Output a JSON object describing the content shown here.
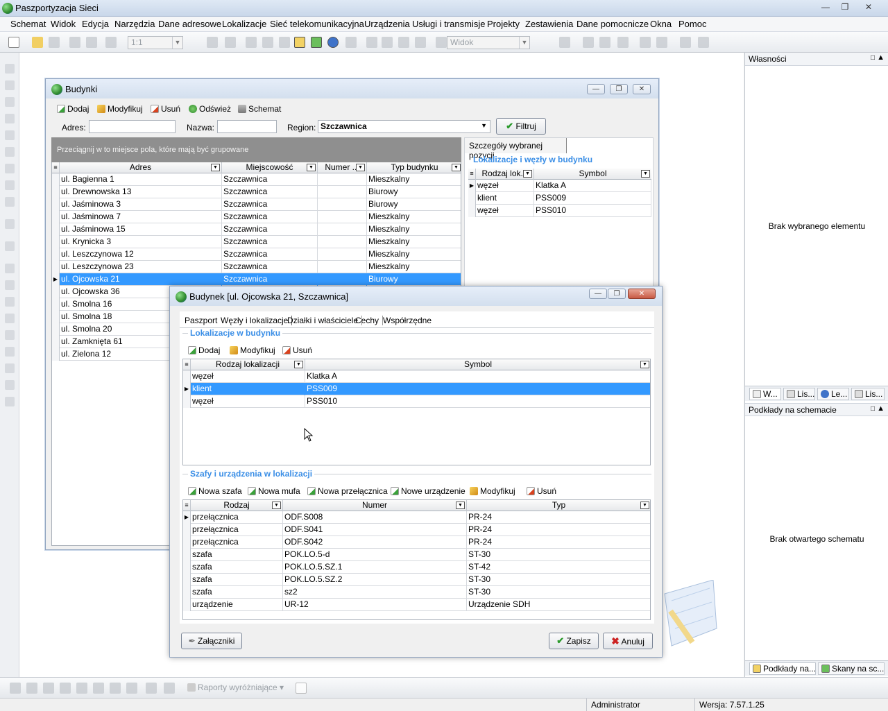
{
  "app": {
    "title": "Paszportyzacja Sieci"
  },
  "menu": [
    "Schemat",
    "Widok",
    "Edycja",
    "Narzędzia",
    "Dane adresowe",
    "Lokalizacje",
    "Sieć telekomunikacyjna",
    "Urządzenia",
    "Usługi i transmisje",
    "Projekty",
    "Zestawienia",
    "Dane pomocnicze",
    "Okna",
    "Pomoc"
  ],
  "toolbar": {
    "zoom_value": "1:1",
    "view_value": "Widok"
  },
  "right_panel": {
    "properties_title": "Własności",
    "properties_empty": "Brak wybranego elementu",
    "tabs": [
      "W...",
      "Lis...",
      "Le...",
      "Lis..."
    ],
    "underlays_title": "Podkłady na schemacie",
    "underlays_empty": "Brak otwartego schematu",
    "bottom_tabs": [
      "Podkłady na...",
      "Skany na sc..."
    ]
  },
  "bottom_toolbar": {
    "reports_label": "Raporty wyróżniające"
  },
  "status": {
    "user": "Administrator",
    "version": "Wersja: 7.57.1.25"
  },
  "buildings": {
    "title": "Budynki",
    "buttons": [
      "Dodaj",
      "Modyfikuj",
      "Usuń",
      "Odśwież",
      "Schemat"
    ],
    "filter": {
      "address_label": "Adres:",
      "address_value": "",
      "name_label": "Nazwa:",
      "name_value": "",
      "region_label": "Region:",
      "region_value": "Szczawnica",
      "filter_button": "Filtruj"
    },
    "group_hint": "Przeciągnij w to miejsce pola, które mają być grupowane",
    "columns": [
      "Adres",
      "Miejscowość",
      "Numer ...",
      "Typ budynku"
    ],
    "rows": [
      [
        "ul. Bagienna 1",
        "Szczawnica",
        "",
        "Mieszkalny"
      ],
      [
        "ul. Drewnowska 13",
        "Szczawnica",
        "",
        "Biurowy"
      ],
      [
        "ul. Jaśminowa 3",
        "Szczawnica",
        "",
        "Biurowy"
      ],
      [
        "ul. Jaśminowa 7",
        "Szczawnica",
        "",
        "Mieszkalny"
      ],
      [
        "ul. Jaśminowa 15",
        "Szczawnica",
        "",
        "Mieszkalny"
      ],
      [
        "ul. Krynicka 3",
        "Szczawnica",
        "",
        "Mieszkalny"
      ],
      [
        "ul. Leszczynowa 12",
        "Szczawnica",
        "",
        "Mieszkalny"
      ],
      [
        "ul. Leszczynowa 23",
        "Szczawnica",
        "",
        "Mieszkalny"
      ],
      [
        "ul. Ojcowska 21",
        "Szczawnica",
        "",
        "Biurowy"
      ],
      [
        "ul. Ojcowska 36",
        "",
        "",
        ""
      ],
      [
        "ul. Smolna 16",
        "",
        "",
        ""
      ],
      [
        "ul. Smolna 18",
        "",
        "",
        ""
      ],
      [
        "ul. Smolna 20",
        "",
        "",
        ""
      ],
      [
        "ul. Zamknięta 61",
        "",
        "",
        ""
      ],
      [
        "ul. Zielona 12",
        "",
        "",
        ""
      ]
    ],
    "selected_row": 8,
    "details": {
      "tab": "Szczegóły wybranej pozycji",
      "section": "Lokalizacje i węzły w budynku",
      "columns": [
        "Rodzaj lok...",
        "Symbol"
      ],
      "rows": [
        [
          "węzeł",
          "Klatka A"
        ],
        [
          "klient",
          "PSS009"
        ],
        [
          "węzeł",
          "PSS010"
        ]
      ]
    }
  },
  "building": {
    "title": "Budynek [ul. Ojcowska 21, Szczawnica]",
    "tabs": [
      "Paszport",
      "Węzły i lokalizacje",
      "Działki i właściciele",
      "Cechy",
      "Współrzędne"
    ],
    "active_tab": 1,
    "locations": {
      "section": "Lokalizacje w budynku",
      "buttons": [
        "Dodaj",
        "Modyfikuj",
        "Usuń"
      ],
      "columns": [
        "Rodzaj lokalizacji",
        "Symbol"
      ],
      "rows": [
        [
          "węzeł",
          "Klatka A"
        ],
        [
          "klient",
          "PSS009"
        ],
        [
          "węzeł",
          "PSS010"
        ]
      ],
      "selected_row": 1
    },
    "cabinets": {
      "section": "Szafy i urządzenia w lokalizacji",
      "buttons": [
        "Nowa szafa",
        "Nowa mufa",
        "Nowa przełącznica",
        "Nowe urządzenie",
        "Modyfikuj",
        "Usuń"
      ],
      "columns": [
        "Rodzaj",
        "Numer",
        "Typ"
      ],
      "rows": [
        [
          "przełącznica",
          "ODF.S008",
          "PR-24"
        ],
        [
          "przełącznica",
          "ODF.S041",
          "PR-24"
        ],
        [
          "przełącznica",
          "ODF.S042",
          "PR-24"
        ],
        [
          "szafa",
          "POK.LO.5-d",
          "ST-30"
        ],
        [
          "szafa",
          "POK.LO.5.SZ.1",
          "ST-42"
        ],
        [
          "szafa",
          "POK.LO.5.SZ.2",
          "ST-30"
        ],
        [
          "szafa",
          "sz2",
          "ST-30"
        ],
        [
          "urządzenie",
          "UR-12",
          "Urządzenie SDH"
        ]
      ]
    },
    "attachments_button": "Załączniki",
    "save_button": "Zapisz",
    "cancel_button": "Anuluj"
  }
}
